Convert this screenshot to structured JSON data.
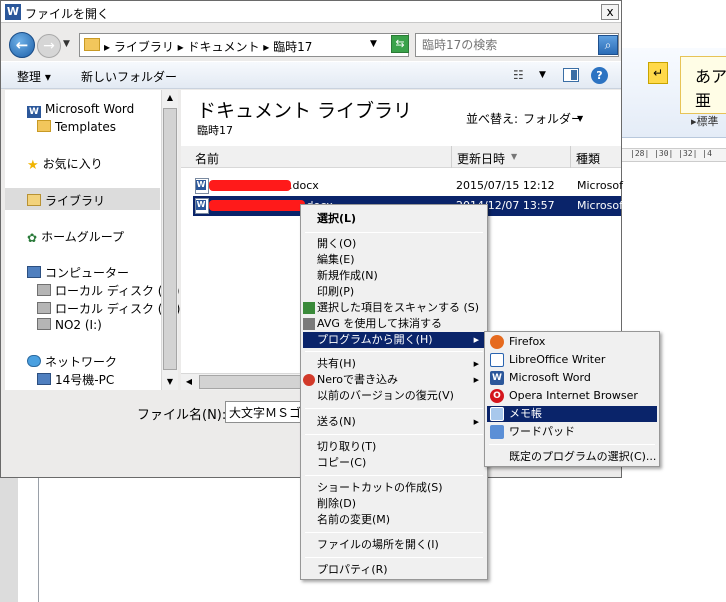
{
  "dialog": {
    "title": "ファイルを開く",
    "close_label": "x"
  },
  "navbar": {
    "breadcrumbs": "▸ ライブラリ ▸ ドキュメント ▸ 臨時17",
    "search_placeholder": "臨時17の検索"
  },
  "toolbar": {
    "organize": "整理 ▾",
    "new_folder": "新しいフォルダー"
  },
  "nav": {
    "items": [
      {
        "label": "Microsoft Word",
        "icon": "word-icon"
      },
      {
        "label": "Templates",
        "icon": "folder-icon"
      },
      {
        "label": "お気に入り",
        "icon": "star-icon"
      },
      {
        "label": "ライブラリ",
        "icon": "library-icon"
      },
      {
        "label": "ホームグループ",
        "icon": "homegroup-icon"
      },
      {
        "label": "コンピューター",
        "icon": "computer-icon"
      },
      {
        "label": "ローカル ディスク (C:)",
        "icon": "disk-icon"
      },
      {
        "label": "ローカル ディスク (D:)",
        "icon": "disk-icon"
      },
      {
        "label": "NO2 (I:)",
        "icon": "drive-icon"
      },
      {
        "label": "ネットワーク",
        "icon": "network-icon"
      },
      {
        "label": "14号機-PC",
        "icon": "computer-icon"
      }
    ]
  },
  "main": {
    "title": "ドキュメント ライブラリ",
    "subtitle": "臨時17",
    "sort_label": "並べ替え:",
    "sort_value": "フォルダー",
    "columns": [
      "名前",
      "更新日時",
      "種類"
    ],
    "files": [
      {
        "name": ".docx",
        "date": "2015/07/15 12:12",
        "type": "Microsof"
      },
      {
        "name": ".docx",
        "date": "2014/12/07 13:57",
        "type": "Microsof"
      }
    ]
  },
  "footer": {
    "filename_label": "ファイル名(N):",
    "filename_value": "大文字ＭＳゴ"
  },
  "context_menu": {
    "items": [
      "選択(L)",
      "開く(O)",
      "編集(E)",
      "新規作成(N)",
      "印刷(P)",
      "選択した項目をスキャンする (S)",
      "AVG を使用して抹消する",
      "プログラムから開く(H)",
      "共有(H)",
      "Neroで書き込み",
      "以前のバージョンの復元(V)",
      "送る(N)",
      "切り取り(T)",
      "コピー(C)",
      "ショートカットの作成(S)",
      "削除(D)",
      "名前の変更(M)",
      "ファイルの場所を開く(I)",
      "プロパティ(R)"
    ]
  },
  "open_with": {
    "items": [
      "Firefox",
      "LibreOffice Writer",
      "Microsoft Word",
      "Opera Internet Browser",
      "メモ帳",
      "ワードパッド"
    ],
    "choose_default": "既定のプログラムの選択(C)..."
  },
  "word_bg": {
    "style_text": "あア亜",
    "style_sub": "▸標準",
    "ruler": "|28| |30| |32| |4"
  },
  "colors": {
    "selection": "#0a246a",
    "redaction": "#ff1a1a"
  }
}
